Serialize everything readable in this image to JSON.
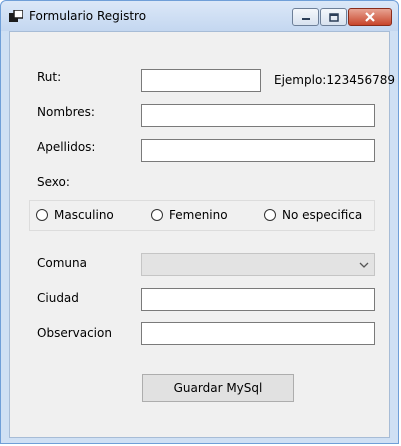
{
  "window": {
    "title": "Formulario Registro"
  },
  "form": {
    "rut_label": "Rut:",
    "rut_value": "",
    "rut_hint": "Ejemplo:123456789",
    "nombres_label": "Nombres:",
    "nombres_value": "",
    "apellidos_label": "Apellidos:",
    "apellidos_value": "",
    "sexo_label": "Sexo:",
    "sexo_options": [
      "Masculino",
      "Femenino",
      "No especifica"
    ],
    "comuna_label": "Comuna",
    "comuna_value": "",
    "ciudad_label": "Ciudad",
    "ciudad_value": "",
    "observacion_label": "Observacion",
    "observacion_value": "",
    "save_label": "Guardar MySql"
  },
  "icons": [
    "app-icon",
    "minimize-icon",
    "maximize-icon",
    "close-icon",
    "chevron-down-icon"
  ]
}
